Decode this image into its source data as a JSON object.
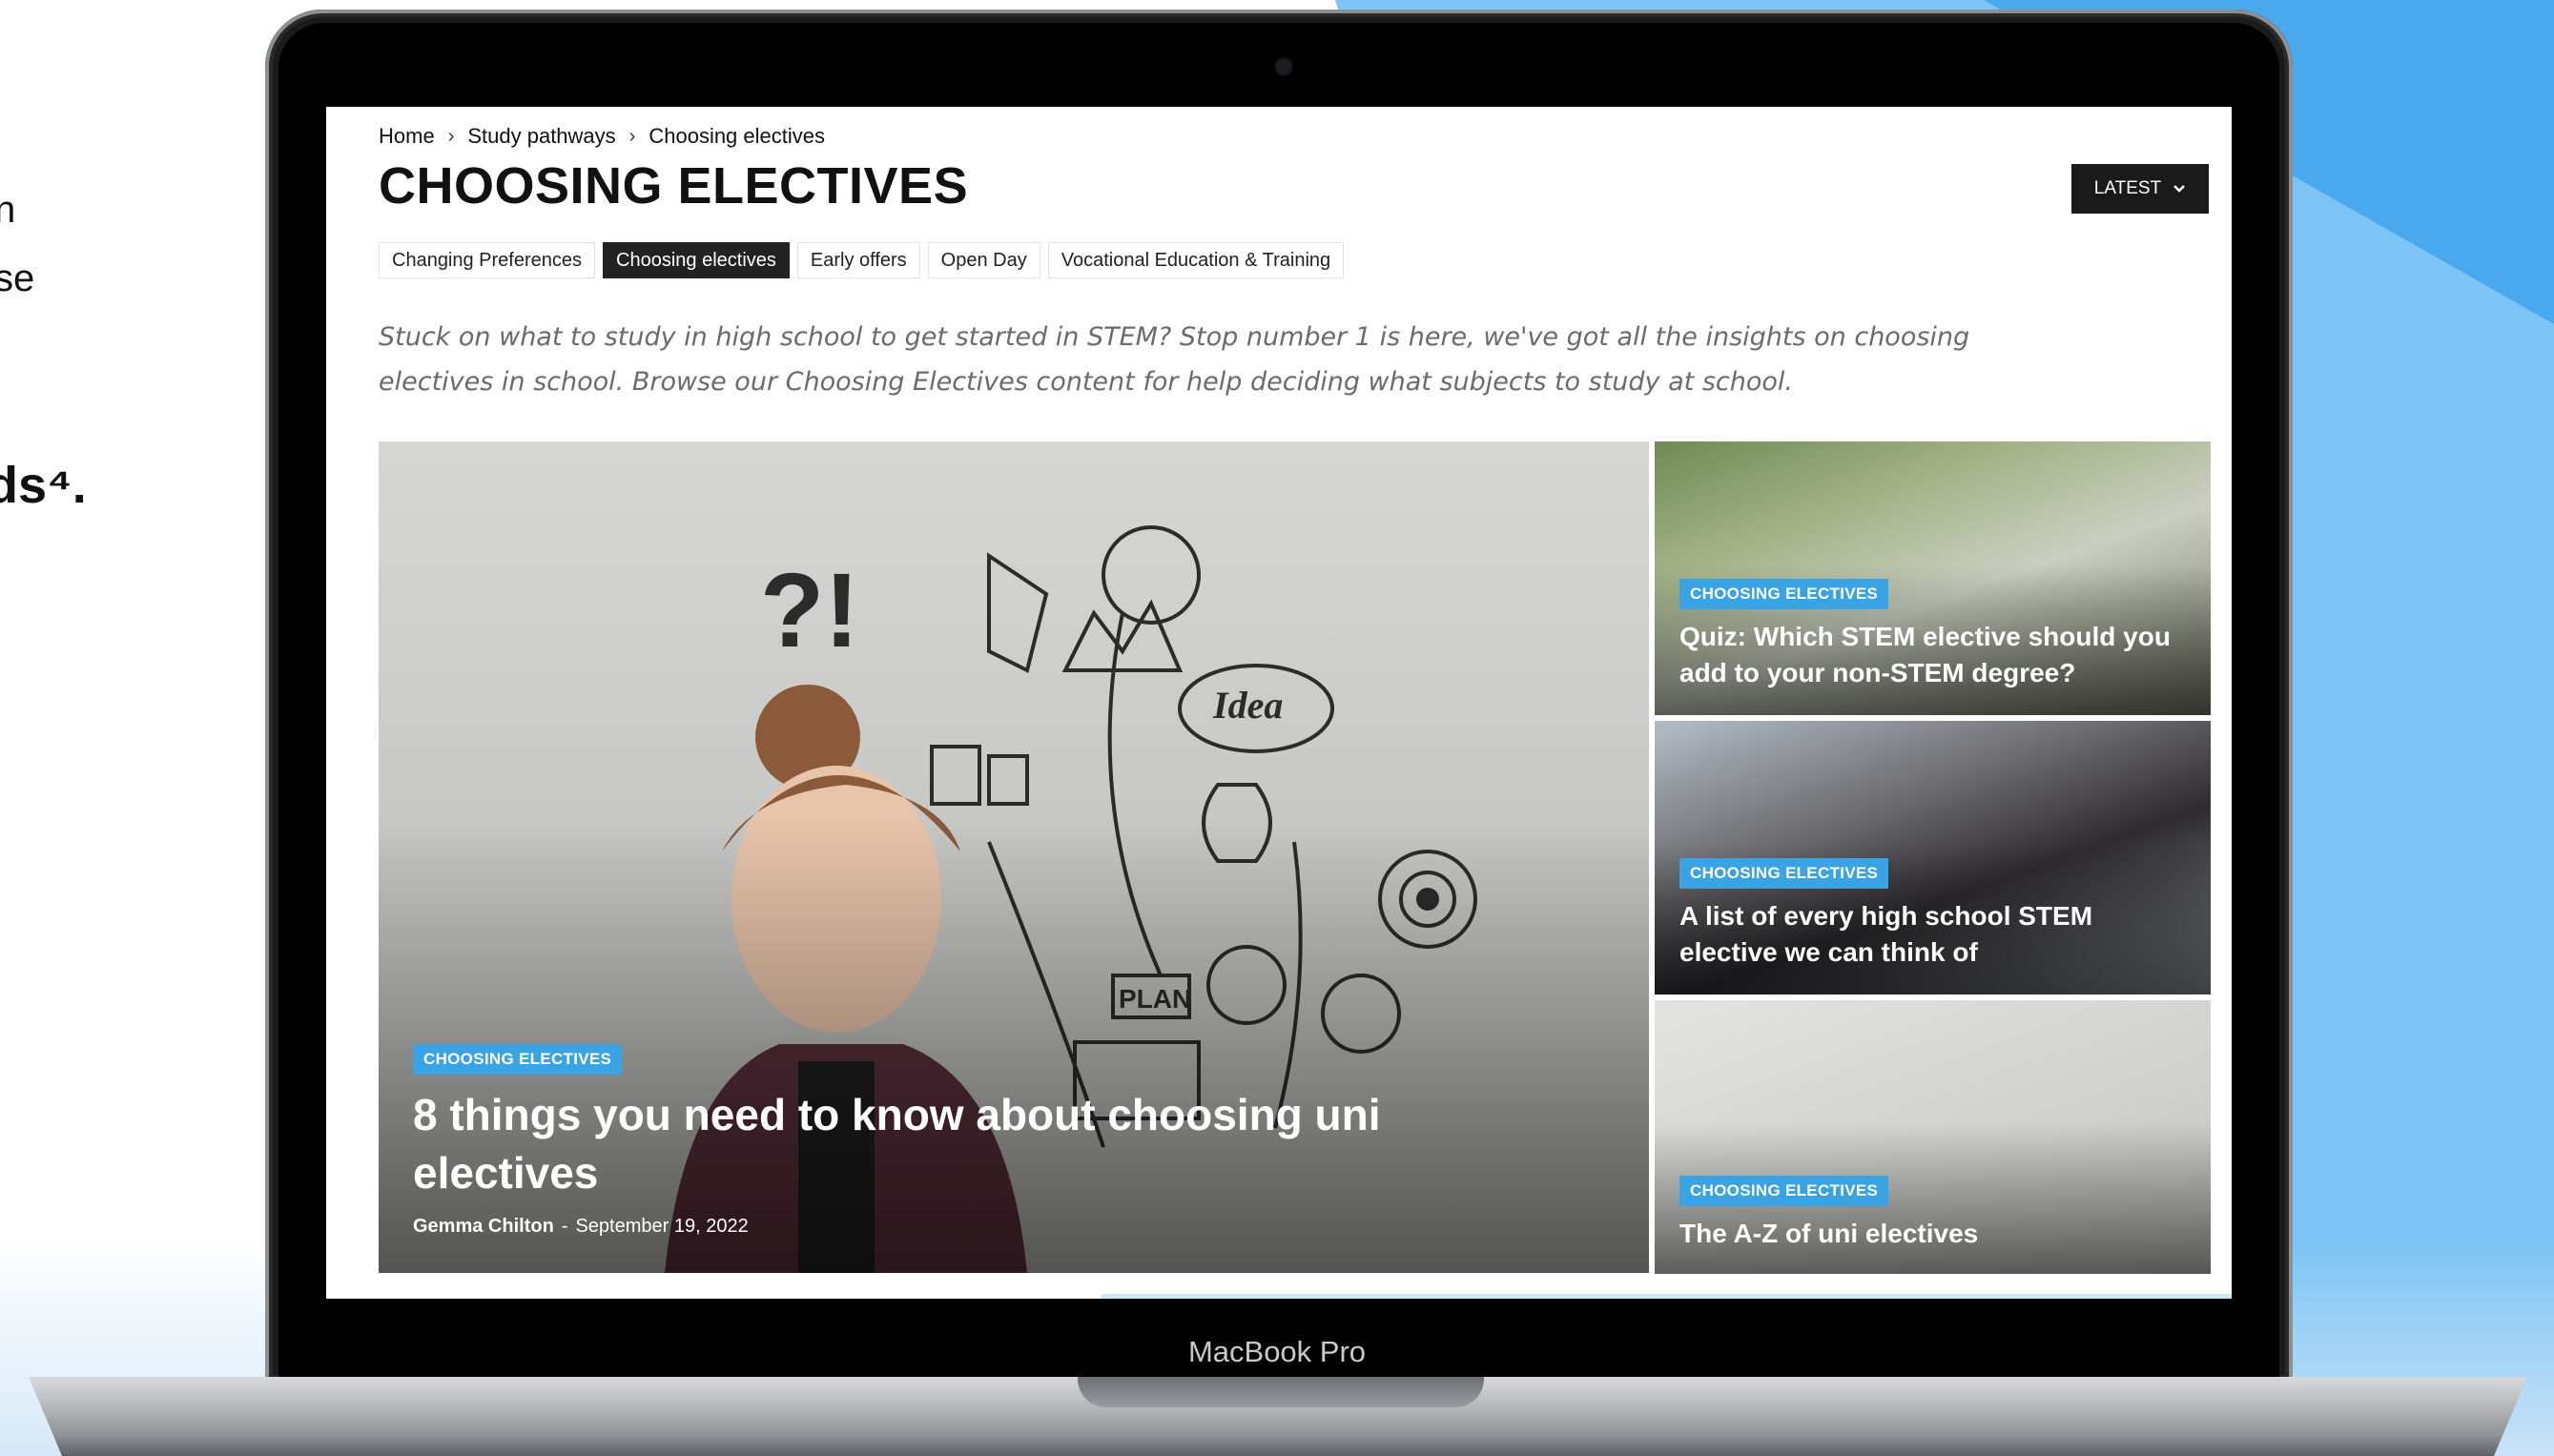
{
  "left_text": {
    "line1": "n",
    "line2": "se",
    "line3": "ds⁴."
  },
  "device_label": "MacBook Pro",
  "breadcrumb": {
    "items": [
      "Home",
      "Study pathways",
      "Choosing electives"
    ],
    "separator": "›"
  },
  "page": {
    "title": "CHOOSING ELECTIVES",
    "sort_button": "LATEST",
    "description": "Stuck on what to study in high school to get started in STEM? Stop number 1 is here, we've got all the insights on choosing electives in school. Browse our Choosing Electives content for help deciding what subjects to study at school."
  },
  "tags": [
    {
      "label": "Changing Preferences",
      "active": false
    },
    {
      "label": "Choosing electives",
      "active": true
    },
    {
      "label": "Early offers",
      "active": false
    },
    {
      "label": "Open Day",
      "active": false
    },
    {
      "label": "Vocational Education & Training",
      "active": false
    }
  ],
  "featured": {
    "category": "CHOOSING ELECTIVES",
    "title": "8 things you need to know about choosing uni electives",
    "author": "Gemma Chilton",
    "separator": "-",
    "date": "September 19, 2022"
  },
  "side_articles": [
    {
      "category": "CHOOSING ELECTIVES",
      "title": "Quiz: Which STEM elective should you add to your non-STEM degree?"
    },
    {
      "category": "CHOOSING ELECTIVES",
      "title": "A list of every high school STEM elective we can think of"
    },
    {
      "category": "CHOOSING ELECTIVES",
      "title": "The A-Z of uni electives"
    }
  ],
  "colors": {
    "badge": "#3aa3e3",
    "active_tag": "#222222",
    "title": "#111111",
    "accent_bg": "#7cc4f5"
  },
  "icons": {
    "sort_chevron": "chevron-down-icon"
  }
}
